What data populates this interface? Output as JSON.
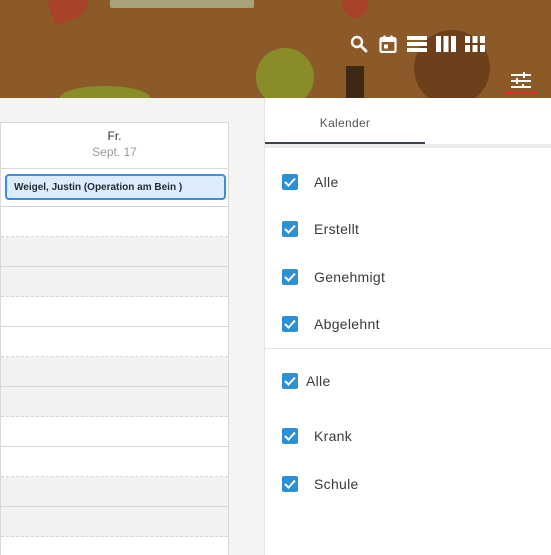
{
  "header": {
    "colors": {
      "banner": "#8b5a28",
      "accent_underline": "#e32b2b"
    },
    "toolbar": [
      {
        "icon": "search-icon"
      },
      {
        "icon": "day-view-icon"
      },
      {
        "icon": "list-view-icon"
      },
      {
        "icon": "week-view-icon"
      },
      {
        "icon": "month-view-icon"
      }
    ],
    "filter_icon": "sliders-icon"
  },
  "calendar": {
    "day": "Fr.",
    "date": "Sept. 17",
    "events": [
      {
        "label": "Weigel, Justin (Operation am Bein )",
        "color": "#3d8de0"
      }
    ]
  },
  "panel": {
    "tab_label": "Kalender",
    "status_filters": [
      {
        "label": "Alle",
        "checked": true
      },
      {
        "label": "Erstellt",
        "checked": true
      },
      {
        "label": "Genehmigt",
        "checked": true
      },
      {
        "label": "Abgelehnt",
        "checked": true
      }
    ],
    "type_filters": [
      {
        "label": "Alle",
        "checked": true
      },
      {
        "label": "Krank",
        "checked": true
      },
      {
        "label": "Schule",
        "checked": true
      }
    ],
    "checkbox_color": "#2d8fd5"
  }
}
